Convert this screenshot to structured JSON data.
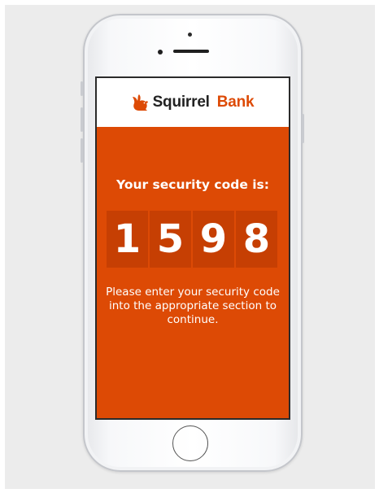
{
  "brand": {
    "name_part1": "Squirrel",
    "name_part2": "Bank",
    "logo_icon": "squirrel-icon",
    "accent_color": "#dd4a05"
  },
  "screen": {
    "headline": "Your security code is:",
    "code_digits": [
      "1",
      "5",
      "9",
      "8"
    ],
    "message": "Please enter your security code into the appropriate section to continue."
  },
  "colors": {
    "screen_background": "#dd4a05",
    "digit_tile": "#c63f03",
    "text_on_accent": "#ffffff"
  }
}
